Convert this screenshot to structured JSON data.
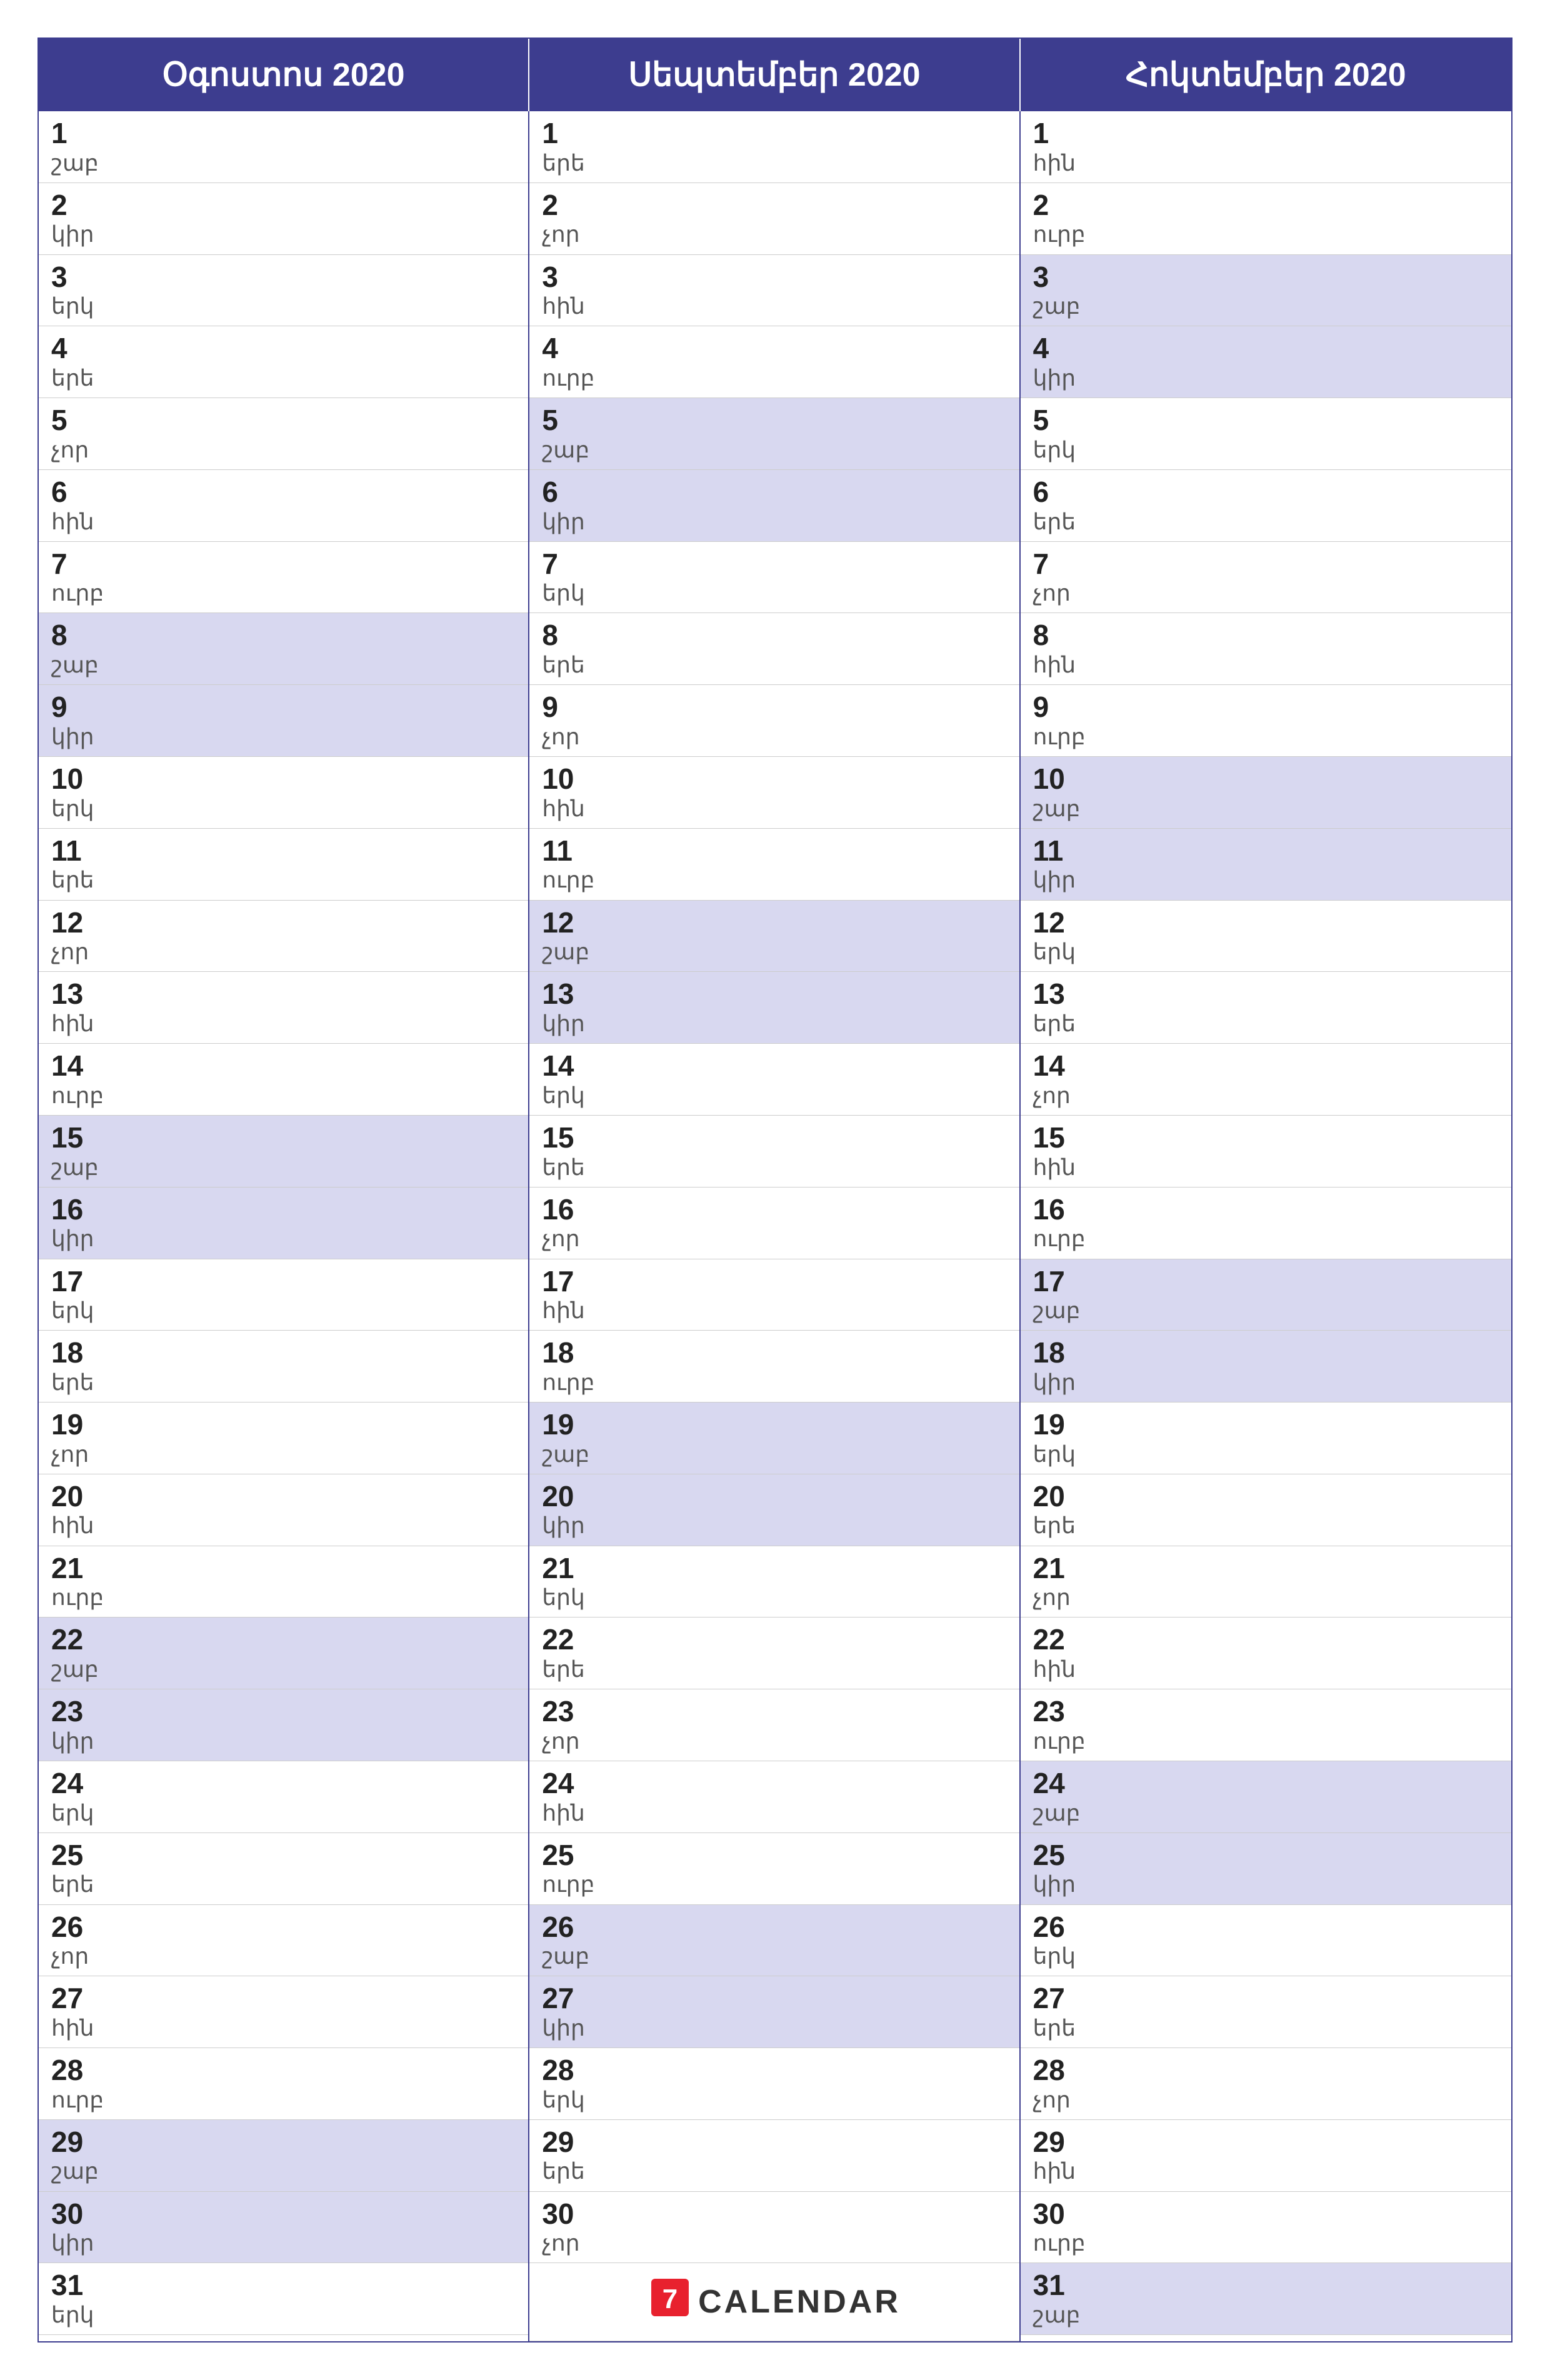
{
  "months": [
    {
      "name": "Օգոստոս 2020",
      "days": [
        {
          "num": "1",
          "day": "շաբ",
          "shaded": false
        },
        {
          "num": "2",
          "day": "կիր",
          "shaded": false
        },
        {
          "num": "3",
          "day": "երկ",
          "shaded": false
        },
        {
          "num": "4",
          "day": "երե",
          "shaded": false
        },
        {
          "num": "5",
          "day": "չոր",
          "shaded": false
        },
        {
          "num": "6",
          "day": "հին",
          "shaded": false
        },
        {
          "num": "7",
          "day": "ուրբ",
          "shaded": false
        },
        {
          "num": "8",
          "day": "շաբ",
          "shaded": true
        },
        {
          "num": "9",
          "day": "կիր",
          "shaded": true
        },
        {
          "num": "10",
          "day": "երկ",
          "shaded": false
        },
        {
          "num": "11",
          "day": "երե",
          "shaded": false
        },
        {
          "num": "12",
          "day": "չոր",
          "shaded": false
        },
        {
          "num": "13",
          "day": "հին",
          "shaded": false
        },
        {
          "num": "14",
          "day": "ուրբ",
          "shaded": false
        },
        {
          "num": "15",
          "day": "շաբ",
          "shaded": true
        },
        {
          "num": "16",
          "day": "կիր",
          "shaded": true
        },
        {
          "num": "17",
          "day": "երկ",
          "shaded": false
        },
        {
          "num": "18",
          "day": "երե",
          "shaded": false
        },
        {
          "num": "19",
          "day": "չոր",
          "shaded": false
        },
        {
          "num": "20",
          "day": "հին",
          "shaded": false
        },
        {
          "num": "21",
          "day": "ուրբ",
          "shaded": false
        },
        {
          "num": "22",
          "day": "շաբ",
          "shaded": true
        },
        {
          "num": "23",
          "day": "կիր",
          "shaded": true
        },
        {
          "num": "24",
          "day": "երկ",
          "shaded": false
        },
        {
          "num": "25",
          "day": "երե",
          "shaded": false
        },
        {
          "num": "26",
          "day": "չոր",
          "shaded": false
        },
        {
          "num": "27",
          "day": "հին",
          "shaded": false
        },
        {
          "num": "28",
          "day": "ուրբ",
          "shaded": false
        },
        {
          "num": "29",
          "day": "շաբ",
          "shaded": true
        },
        {
          "num": "30",
          "day": "կիր",
          "shaded": true
        },
        {
          "num": "31",
          "day": "երկ",
          "shaded": false
        }
      ]
    },
    {
      "name": "Սեպտեմբեր 2020",
      "days": [
        {
          "num": "1",
          "day": "երե",
          "shaded": false
        },
        {
          "num": "2",
          "day": "չոր",
          "shaded": false
        },
        {
          "num": "3",
          "day": "հին",
          "shaded": false
        },
        {
          "num": "4",
          "day": "ուրբ",
          "shaded": false
        },
        {
          "num": "5",
          "day": "շաբ",
          "shaded": true
        },
        {
          "num": "6",
          "day": "կիր",
          "shaded": true
        },
        {
          "num": "7",
          "day": "երկ",
          "shaded": false
        },
        {
          "num": "8",
          "day": "երե",
          "shaded": false
        },
        {
          "num": "9",
          "day": "չոր",
          "shaded": false
        },
        {
          "num": "10",
          "day": "հին",
          "shaded": false
        },
        {
          "num": "11",
          "day": "ուրբ",
          "shaded": false
        },
        {
          "num": "12",
          "day": "շաբ",
          "shaded": true
        },
        {
          "num": "13",
          "day": "կիր",
          "shaded": true
        },
        {
          "num": "14",
          "day": "երկ",
          "shaded": false
        },
        {
          "num": "15",
          "day": "երե",
          "shaded": false
        },
        {
          "num": "16",
          "day": "չոր",
          "shaded": false
        },
        {
          "num": "17",
          "day": "հին",
          "shaded": false
        },
        {
          "num": "18",
          "day": "ուրբ",
          "shaded": false
        },
        {
          "num": "19",
          "day": "շաբ",
          "shaded": true
        },
        {
          "num": "20",
          "day": "կիր",
          "shaded": true
        },
        {
          "num": "21",
          "day": "երկ",
          "shaded": false
        },
        {
          "num": "22",
          "day": "երե",
          "shaded": false
        },
        {
          "num": "23",
          "day": "չոր",
          "shaded": false
        },
        {
          "num": "24",
          "day": "հին",
          "shaded": false
        },
        {
          "num": "25",
          "day": "ուրբ",
          "shaded": false
        },
        {
          "num": "26",
          "day": "շաբ",
          "shaded": true
        },
        {
          "num": "27",
          "day": "կիր",
          "shaded": true
        },
        {
          "num": "28",
          "day": "երկ",
          "shaded": false
        },
        {
          "num": "29",
          "day": "երե",
          "shaded": false
        },
        {
          "num": "30",
          "day": "չոր",
          "shaded": false
        }
      ]
    },
    {
      "name": "Հոկտեմբեր 2020",
      "days": [
        {
          "num": "1",
          "day": "հին",
          "shaded": false
        },
        {
          "num": "2",
          "day": "ուրբ",
          "shaded": false
        },
        {
          "num": "3",
          "day": "շաբ",
          "shaded": true
        },
        {
          "num": "4",
          "day": "կիր",
          "shaded": true
        },
        {
          "num": "5",
          "day": "երկ",
          "shaded": false
        },
        {
          "num": "6",
          "day": "երե",
          "shaded": false
        },
        {
          "num": "7",
          "day": "չոր",
          "shaded": false
        },
        {
          "num": "8",
          "day": "հին",
          "shaded": false
        },
        {
          "num": "9",
          "day": "ուրբ",
          "shaded": false
        },
        {
          "num": "10",
          "day": "շաբ",
          "shaded": true
        },
        {
          "num": "11",
          "day": "կիր",
          "shaded": true
        },
        {
          "num": "12",
          "day": "երկ",
          "shaded": false
        },
        {
          "num": "13",
          "day": "երե",
          "shaded": false
        },
        {
          "num": "14",
          "day": "չոր",
          "shaded": false
        },
        {
          "num": "15",
          "day": "հին",
          "shaded": false
        },
        {
          "num": "16",
          "day": "ուրբ",
          "shaded": false
        },
        {
          "num": "17",
          "day": "շաբ",
          "shaded": true
        },
        {
          "num": "18",
          "day": "կիր",
          "shaded": true
        },
        {
          "num": "19",
          "day": "երկ",
          "shaded": false
        },
        {
          "num": "20",
          "day": "երե",
          "shaded": false
        },
        {
          "num": "21",
          "day": "չոր",
          "shaded": false
        },
        {
          "num": "22",
          "day": "հին",
          "shaded": false
        },
        {
          "num": "23",
          "day": "ուրբ",
          "shaded": false
        },
        {
          "num": "24",
          "day": "շաբ",
          "shaded": true
        },
        {
          "num": "25",
          "day": "կիր",
          "shaded": true
        },
        {
          "num": "26",
          "day": "երկ",
          "shaded": false
        },
        {
          "num": "27",
          "day": "երե",
          "shaded": false
        },
        {
          "num": "28",
          "day": "չոր",
          "shaded": false
        },
        {
          "num": "29",
          "day": "հին",
          "shaded": false
        },
        {
          "num": "30",
          "day": "ուրբ",
          "shaded": false
        },
        {
          "num": "31",
          "day": "շաբ",
          "shaded": true
        }
      ]
    }
  ],
  "logo": {
    "icon": "7",
    "text": "CALENDAR"
  }
}
